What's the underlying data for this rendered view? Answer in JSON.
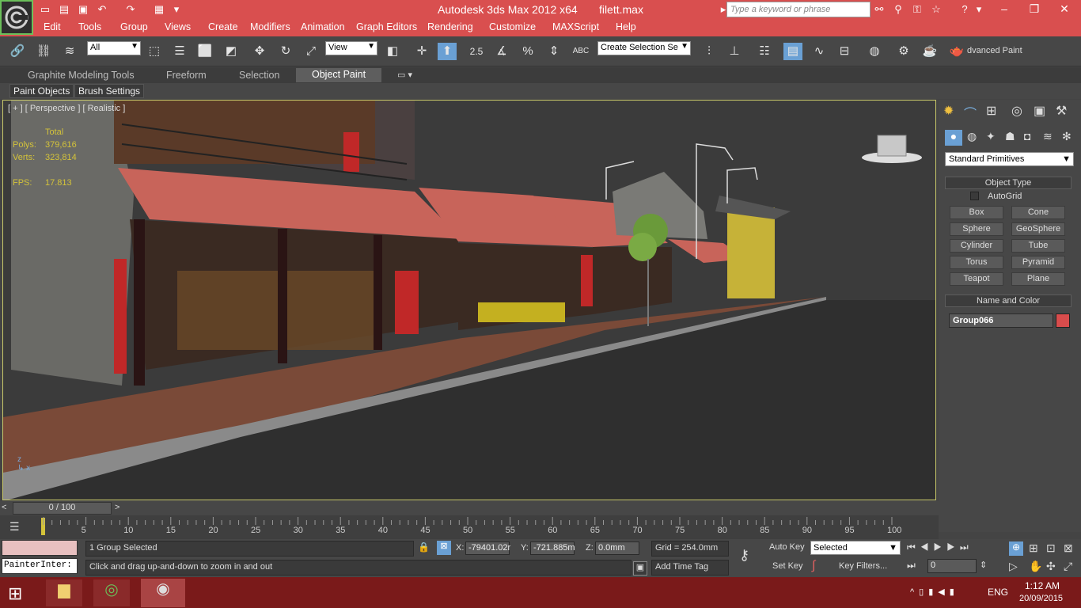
{
  "title_bar": {
    "app": "Autodesk 3ds Max  2012 x64",
    "file": "filett.max",
    "search_placeholder": "Type a keyword or phrase"
  },
  "menu": [
    "Edit",
    "Tools",
    "Group",
    "Views",
    "Create",
    "Modifiers",
    "Animation",
    "Graph Editors",
    "Rendering",
    "Customize",
    "MAXScript",
    "Help"
  ],
  "toolbar": {
    "filter": "All",
    "ref_coord": "View",
    "snap_angle": "2.5",
    "selection_set": "Create Selection Se",
    "render_label": "dvanced Paint"
  },
  "ribbon": {
    "tabs": [
      "Graphite Modeling Tools",
      "Freeform",
      "Selection",
      "Object Paint"
    ],
    "active_tab": "Object Paint",
    "sub_buttons": [
      "Paint Objects",
      "Brush Settings"
    ]
  },
  "viewport": {
    "label": "[ + ] [ Perspective ] [ Realistic ]",
    "stats": {
      "header": "Total",
      "polys_label": "Polys:",
      "polys": "379,616",
      "verts_label": "Verts:",
      "verts": "323,814",
      "fps_label": "FPS:",
      "fps": "17.813"
    }
  },
  "command_panel": {
    "category": "Standard Primitives",
    "object_type_title": "Object Type",
    "autogrid": "AutoGrid",
    "buttons": [
      "Box",
      "Cone",
      "Sphere",
      "GeoSphere",
      "Cylinder",
      "Tube",
      "Torus",
      "Pyramid",
      "Teapot",
      "Plane"
    ],
    "name_color_title": "Name and Color",
    "object_name": "Group066",
    "object_color": "#d84c4c"
  },
  "timeline": {
    "frame": "0 / 100",
    "ticks": [
      "0",
      "5",
      "10",
      "15",
      "20",
      "25",
      "30",
      "35",
      "40",
      "45",
      "50",
      "55",
      "60",
      "65",
      "70",
      "75",
      "80",
      "85",
      "90",
      "95",
      "100"
    ]
  },
  "status": {
    "script_listener": "PainterInter:",
    "selected": "1 Group Selected",
    "prompt": "Click and drag up-and-down to zoom in and out",
    "x_label": "X:",
    "x": "-79401.02r",
    "y_label": "Y:",
    "y": "-721.885m",
    "z_label": "Z:",
    "z": "0.0mm",
    "grid": "Grid = 254.0mm",
    "add_time_tag": "Add Time Tag",
    "auto_key": "Auto Key",
    "set_key": "Set Key",
    "key_mode": "Selected",
    "key_filters": "Key Filters...",
    "current_frame": "0"
  },
  "taskbar": {
    "lang": "ENG",
    "time": "1:12 AM",
    "date": "20/09/2015"
  }
}
